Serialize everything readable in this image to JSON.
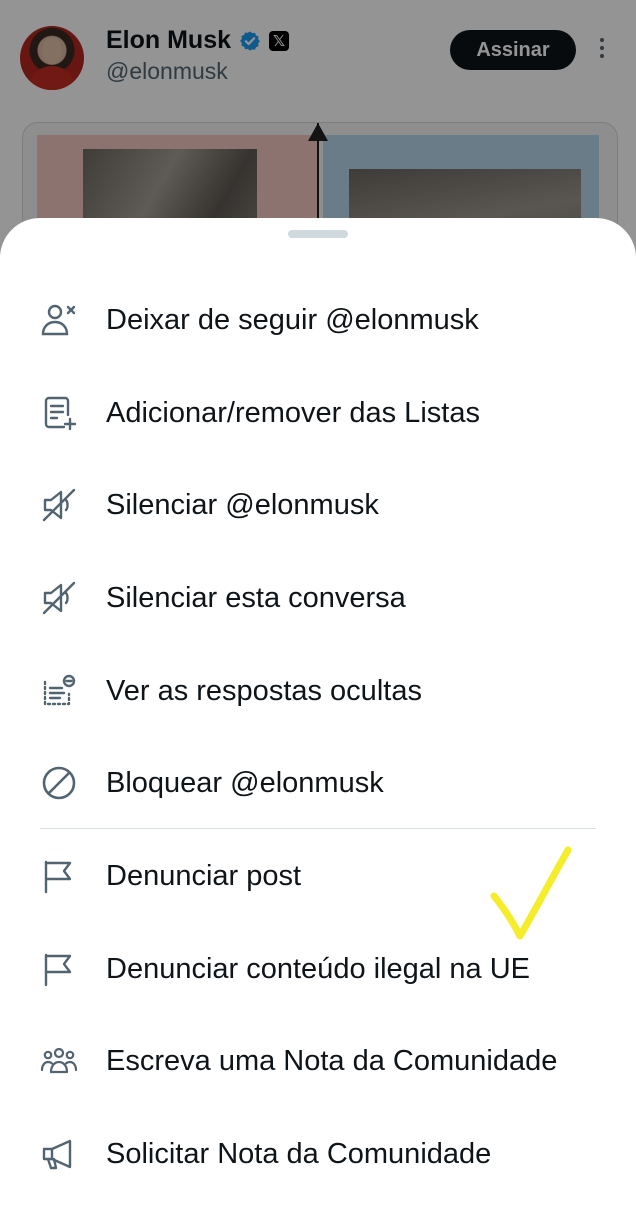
{
  "post": {
    "author_name": "Elon Musk",
    "x_badge": "𝕏",
    "author_handle": "@elonmusk",
    "subscribe_label": "Assinar"
  },
  "menu": {
    "items": [
      {
        "label": "Deixar de seguir @elonmusk",
        "icon": "unfollow-icon"
      },
      {
        "label": "Adicionar/remover das Listas",
        "icon": "list-add-icon"
      },
      {
        "label": "Silenciar @elonmusk",
        "icon": "mute-icon"
      },
      {
        "label": "Silenciar esta conversa",
        "icon": "mute-conversation-icon"
      },
      {
        "label": "Ver as respostas ocultas",
        "icon": "hidden-replies-icon"
      },
      {
        "label": "Bloquear @elonmusk",
        "icon": "block-icon"
      },
      {
        "label": "Denunciar post",
        "icon": "flag-icon"
      },
      {
        "label": "Denunciar conteúdo ilegal na UE",
        "icon": "flag-icon"
      },
      {
        "label": "Escreva uma Nota da Comunidade",
        "icon": "community-icon"
      },
      {
        "label": "Solicitar Nota da Comunidade",
        "icon": "megaphone-icon"
      }
    ]
  },
  "colors": {
    "text": "#0f1419",
    "icon": "#536471",
    "verified": "#1d9bf0",
    "annotation": "#f5ec2b"
  }
}
